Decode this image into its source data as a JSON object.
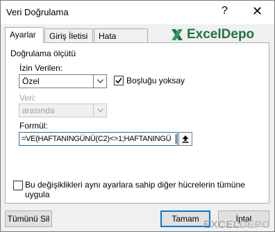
{
  "window": {
    "title": "Veri Doğrulama",
    "help": "?",
    "close": "✕"
  },
  "tabs": [
    {
      "label": "Ayarlar",
      "active": true
    },
    {
      "label": "Giriş İletisi",
      "active": false
    },
    {
      "label": "Hata Uyarısı",
      "active": false
    }
  ],
  "logo": {
    "text": "ExcelDepo",
    "color": "#217346"
  },
  "criteria": {
    "group_label": "Doğrulama ölçütü",
    "allow_label": "İzin Verilen:",
    "allow_value": "Özel",
    "ignore_blank_label": "Boşluğu yoksay",
    "ignore_blank_checked": true,
    "data_label": "Veri:",
    "data_value": "arasında",
    "formula_label": "Formül:",
    "formula_value": "=VE(HAFTANINGÜNÜ(C2)<>1;HAFTANINGÜ"
  },
  "apply_all": {
    "label": "Bu değişiklikleri aynı ayarlara sahip diğer hücrelerin tümüne uygula",
    "checked": false
  },
  "buttons": {
    "clear_all": "Tümünü Sil",
    "ok": "Tamam",
    "cancel": "İptal"
  },
  "watermark": {
    "part1": "EXCEL",
    "part2": "DEPO"
  },
  "icons": {
    "close": "close-icon",
    "dropdown": "chevron-down-icon",
    "collapse": "collapse-dialog-icon",
    "check": "checkmark-icon"
  }
}
